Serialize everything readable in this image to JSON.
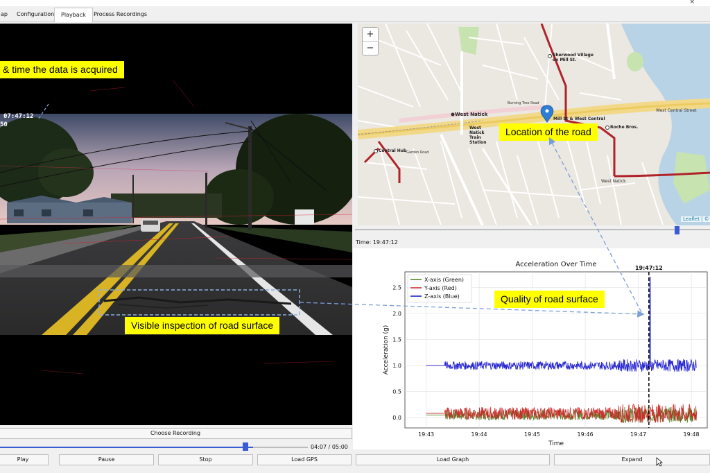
{
  "window": {
    "close_glyph": "×"
  },
  "tabs": [
    {
      "label": "ap"
    },
    {
      "label": "Configuration"
    },
    {
      "label": "Playback"
    },
    {
      "label": "Process Recordings"
    }
  ],
  "video": {
    "timestamp": "07:47:12",
    "speed": "50"
  },
  "annotations": {
    "time_acquired": "& time the data is acquired",
    "road_inspection": "Visible inspection of road surface",
    "location": "Location of the road",
    "quality": "Quality of road surface"
  },
  "map": {
    "zoom_in": "+",
    "zoom_out": "−",
    "attribution": "Leaflet | ©",
    "labels": {
      "west_natick": "West Natick",
      "west_natick_train": "West Natick Train Station",
      "sherwood": "Sherwood Village on Mill St.",
      "mill_st": "Mill St & West Central",
      "roche": "Roche Bros.",
      "central_hub": "Central Hub",
      "west_natick_2": "West Natick",
      "burning_tree": "Burning Tree Road",
      "west_central": "West Central Street",
      "garden_road": "Garden Road"
    },
    "position_fraction": 0.92
  },
  "time_label": "Time: 19:47:12",
  "chart_data": {
    "type": "line",
    "title": "Acceleration Over Time",
    "xlabel": "Time",
    "ylabel": "Acceleration (g)",
    "x_ticks": [
      "19:43",
      "19:44",
      "19:45",
      "19:46",
      "19:47",
      "19:48"
    ],
    "y_ticks": [
      "0.0",
      "0.5",
      "1.0",
      "1.5",
      "2.0",
      "2.5"
    ],
    "ylim": [
      -0.2,
      2.8
    ],
    "xlim_minutes": [
      42.6,
      48.3
    ],
    "marker_label": "19:47:12",
    "marker_x_minutes": 47.2,
    "grid": true,
    "legend_position": "top-left",
    "series": [
      {
        "name": "X-axis (Green)",
        "color": "#4a7a1a",
        "baseline": 0.05,
        "noise": 0.1,
        "start_minutes": 43.0,
        "end_minutes": 48.1
      },
      {
        "name": "Y-axis (Red)",
        "color": "#cc2222",
        "baseline": 0.08,
        "noise": 0.12,
        "start_minutes": 43.0,
        "end_minutes": 48.1
      },
      {
        "name": "Z-axis (Blue)",
        "color": "#1010cc",
        "baseline": 1.0,
        "noise": 0.08,
        "start_minutes": 43.0,
        "end_minutes": 48.1,
        "peak": 2.7,
        "peak_minutes": 47.22
      }
    ]
  },
  "controls": {
    "choose_recording": "Choose Recording",
    "seek_time": "04:07 / 05:00",
    "seek_fraction": 0.823,
    "play": "Play",
    "pause": "Pause",
    "stop": "Stop",
    "load_gps": "Load GPS",
    "load_graph": "Load Graph",
    "expand": "Expand"
  }
}
